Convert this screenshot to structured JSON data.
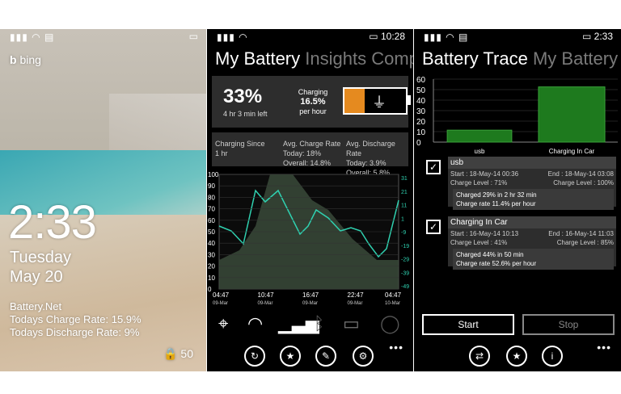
{
  "lock": {
    "bing": "bing",
    "time": "2:33",
    "day": "Tuesday",
    "date": "May 20",
    "app": "Battery.Net",
    "charge_line": "Todays Charge Rate: 15.9%",
    "discharge_line": "Todays Discharge Rate: 9%",
    "battery_level": "50"
  },
  "battery": {
    "status_time": "10:28",
    "pivot": [
      "My Battery",
      "Insights",
      "Comp"
    ],
    "percent": "33%",
    "time_left": "4 hr 3 min left",
    "charging_label": "Charging",
    "rate": "16.5%",
    "per_hour": "per hour",
    "charge_fill": 0.33,
    "since_label": "Charging Since",
    "since_value": "1 hr",
    "avg_charge_label": "Avg. Charge Rate",
    "avg_charge_today": "Today: 18%",
    "avg_charge_overall": "Overall: 14.8%",
    "avg_discharge_label": "Avg. Discharge Rate",
    "avg_discharge_today": "Today: 3.9%",
    "avg_discharge_overall": "Overall: 5.8%",
    "left_ticks": [
      "100",
      "90",
      "80",
      "70",
      "60",
      "50",
      "40",
      "30",
      "20",
      "10",
      "0"
    ],
    "right_ticks": [
      "31",
      "21",
      "11",
      "1",
      "-9",
      "-19",
      "-29",
      "-39",
      "-49"
    ],
    "x_ticks": [
      {
        "time": "04:47",
        "date": "09-Mar"
      },
      {
        "time": "10:47",
        "date": "09-Mar"
      },
      {
        "time": "16:47",
        "date": "09-Mar"
      },
      {
        "time": "22:47",
        "date": "09-Mar"
      },
      {
        "time": "04:47",
        "date": "10-Mar"
      }
    ]
  },
  "trace": {
    "status_time": "2:33",
    "pivot": [
      "Battery Trace",
      "My Battery"
    ],
    "chart_data": {
      "type": "bar",
      "categories": [
        "usb",
        "Charging In Car"
      ],
      "values": [
        11.4,
        52.6
      ],
      "ylim": [
        0,
        60
      ],
      "yticks": [
        0,
        10,
        20,
        30,
        40,
        50,
        60
      ],
      "bar_color": "#1e7a1e"
    },
    "entries": [
      {
        "name": "usb",
        "start": "Start : 18-May-14 00:36",
        "end": "End : 18-May-14 03:08",
        "level_start": "Charge Level : 71%",
        "level_end": "Charge Level : 100%",
        "charged": "Charged 29%  in  2 hr 32 min",
        "rate": "Charge rate 11.4% per hour"
      },
      {
        "name": "Charging In Car",
        "start": "Start : 16-May-14 10:13",
        "end": "End : 16-May-14 11:03",
        "level_start": "Charge Level : 41%",
        "level_end": "Charge Level : 85%",
        "charged": "Charged 44%  in  50 min",
        "rate": "Charge rate 52.6% per hour"
      }
    ],
    "start_label": "Start",
    "stop_label": "Stop"
  },
  "colors": {
    "accent": "#e58a1f",
    "charge_line": "#2fd1b0",
    "bar": "#1e7a1e"
  }
}
